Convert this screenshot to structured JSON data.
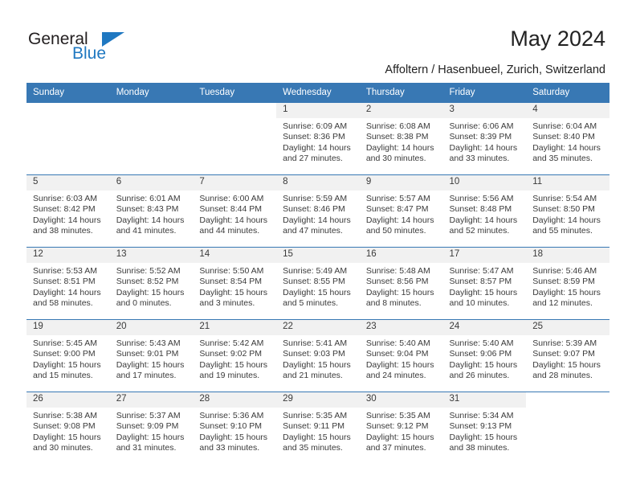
{
  "brand": {
    "name_dark": "General",
    "name_blue": "Blue",
    "accent_color": "#1f78c1",
    "header_color": "#3878b4"
  },
  "header": {
    "title": "May 2024",
    "subtitle": "Affoltern / Hasenbueel, Zurich, Switzerland"
  },
  "calendar": {
    "weekday_headers": [
      "Sunday",
      "Monday",
      "Tuesday",
      "Wednesday",
      "Thursday",
      "Friday",
      "Saturday"
    ],
    "weeks": [
      [
        {
          "date": "",
          "sunrise": "",
          "sunset": "",
          "daylight_1": "",
          "daylight_2": ""
        },
        {
          "date": "",
          "sunrise": "",
          "sunset": "",
          "daylight_1": "",
          "daylight_2": ""
        },
        {
          "date": "",
          "sunrise": "",
          "sunset": "",
          "daylight_1": "",
          "daylight_2": ""
        },
        {
          "date": "1",
          "sunrise": "Sunrise: 6:09 AM",
          "sunset": "Sunset: 8:36 PM",
          "daylight_1": "Daylight: 14 hours",
          "daylight_2": "and 27 minutes."
        },
        {
          "date": "2",
          "sunrise": "Sunrise: 6:08 AM",
          "sunset": "Sunset: 8:38 PM",
          "daylight_1": "Daylight: 14 hours",
          "daylight_2": "and 30 minutes."
        },
        {
          "date": "3",
          "sunrise": "Sunrise: 6:06 AM",
          "sunset": "Sunset: 8:39 PM",
          "daylight_1": "Daylight: 14 hours",
          "daylight_2": "and 33 minutes."
        },
        {
          "date": "4",
          "sunrise": "Sunrise: 6:04 AM",
          "sunset": "Sunset: 8:40 PM",
          "daylight_1": "Daylight: 14 hours",
          "daylight_2": "and 35 minutes."
        }
      ],
      [
        {
          "date": "5",
          "sunrise": "Sunrise: 6:03 AM",
          "sunset": "Sunset: 8:42 PM",
          "daylight_1": "Daylight: 14 hours",
          "daylight_2": "and 38 minutes."
        },
        {
          "date": "6",
          "sunrise": "Sunrise: 6:01 AM",
          "sunset": "Sunset: 8:43 PM",
          "daylight_1": "Daylight: 14 hours",
          "daylight_2": "and 41 minutes."
        },
        {
          "date": "7",
          "sunrise": "Sunrise: 6:00 AM",
          "sunset": "Sunset: 8:44 PM",
          "daylight_1": "Daylight: 14 hours",
          "daylight_2": "and 44 minutes."
        },
        {
          "date": "8",
          "sunrise": "Sunrise: 5:59 AM",
          "sunset": "Sunset: 8:46 PM",
          "daylight_1": "Daylight: 14 hours",
          "daylight_2": "and 47 minutes."
        },
        {
          "date": "9",
          "sunrise": "Sunrise: 5:57 AM",
          "sunset": "Sunset: 8:47 PM",
          "daylight_1": "Daylight: 14 hours",
          "daylight_2": "and 50 minutes."
        },
        {
          "date": "10",
          "sunrise": "Sunrise: 5:56 AM",
          "sunset": "Sunset: 8:48 PM",
          "daylight_1": "Daylight: 14 hours",
          "daylight_2": "and 52 minutes."
        },
        {
          "date": "11",
          "sunrise": "Sunrise: 5:54 AM",
          "sunset": "Sunset: 8:50 PM",
          "daylight_1": "Daylight: 14 hours",
          "daylight_2": "and 55 minutes."
        }
      ],
      [
        {
          "date": "12",
          "sunrise": "Sunrise: 5:53 AM",
          "sunset": "Sunset: 8:51 PM",
          "daylight_1": "Daylight: 14 hours",
          "daylight_2": "and 58 minutes."
        },
        {
          "date": "13",
          "sunrise": "Sunrise: 5:52 AM",
          "sunset": "Sunset: 8:52 PM",
          "daylight_1": "Daylight: 15 hours",
          "daylight_2": "and 0 minutes."
        },
        {
          "date": "14",
          "sunrise": "Sunrise: 5:50 AM",
          "sunset": "Sunset: 8:54 PM",
          "daylight_1": "Daylight: 15 hours",
          "daylight_2": "and 3 minutes."
        },
        {
          "date": "15",
          "sunrise": "Sunrise: 5:49 AM",
          "sunset": "Sunset: 8:55 PM",
          "daylight_1": "Daylight: 15 hours",
          "daylight_2": "and 5 minutes."
        },
        {
          "date": "16",
          "sunrise": "Sunrise: 5:48 AM",
          "sunset": "Sunset: 8:56 PM",
          "daylight_1": "Daylight: 15 hours",
          "daylight_2": "and 8 minutes."
        },
        {
          "date": "17",
          "sunrise": "Sunrise: 5:47 AM",
          "sunset": "Sunset: 8:57 PM",
          "daylight_1": "Daylight: 15 hours",
          "daylight_2": "and 10 minutes."
        },
        {
          "date": "18",
          "sunrise": "Sunrise: 5:46 AM",
          "sunset": "Sunset: 8:59 PM",
          "daylight_1": "Daylight: 15 hours",
          "daylight_2": "and 12 minutes."
        }
      ],
      [
        {
          "date": "19",
          "sunrise": "Sunrise: 5:45 AM",
          "sunset": "Sunset: 9:00 PM",
          "daylight_1": "Daylight: 15 hours",
          "daylight_2": "and 15 minutes."
        },
        {
          "date": "20",
          "sunrise": "Sunrise: 5:43 AM",
          "sunset": "Sunset: 9:01 PM",
          "daylight_1": "Daylight: 15 hours",
          "daylight_2": "and 17 minutes."
        },
        {
          "date": "21",
          "sunrise": "Sunrise: 5:42 AM",
          "sunset": "Sunset: 9:02 PM",
          "daylight_1": "Daylight: 15 hours",
          "daylight_2": "and 19 minutes."
        },
        {
          "date": "22",
          "sunrise": "Sunrise: 5:41 AM",
          "sunset": "Sunset: 9:03 PM",
          "daylight_1": "Daylight: 15 hours",
          "daylight_2": "and 21 minutes."
        },
        {
          "date": "23",
          "sunrise": "Sunrise: 5:40 AM",
          "sunset": "Sunset: 9:04 PM",
          "daylight_1": "Daylight: 15 hours",
          "daylight_2": "and 24 minutes."
        },
        {
          "date": "24",
          "sunrise": "Sunrise: 5:40 AM",
          "sunset": "Sunset: 9:06 PM",
          "daylight_1": "Daylight: 15 hours",
          "daylight_2": "and 26 minutes."
        },
        {
          "date": "25",
          "sunrise": "Sunrise: 5:39 AM",
          "sunset": "Sunset: 9:07 PM",
          "daylight_1": "Daylight: 15 hours",
          "daylight_2": "and 28 minutes."
        }
      ],
      [
        {
          "date": "26",
          "sunrise": "Sunrise: 5:38 AM",
          "sunset": "Sunset: 9:08 PM",
          "daylight_1": "Daylight: 15 hours",
          "daylight_2": "and 30 minutes."
        },
        {
          "date": "27",
          "sunrise": "Sunrise: 5:37 AM",
          "sunset": "Sunset: 9:09 PM",
          "daylight_1": "Daylight: 15 hours",
          "daylight_2": "and 31 minutes."
        },
        {
          "date": "28",
          "sunrise": "Sunrise: 5:36 AM",
          "sunset": "Sunset: 9:10 PM",
          "daylight_1": "Daylight: 15 hours",
          "daylight_2": "and 33 minutes."
        },
        {
          "date": "29",
          "sunrise": "Sunrise: 5:35 AM",
          "sunset": "Sunset: 9:11 PM",
          "daylight_1": "Daylight: 15 hours",
          "daylight_2": "and 35 minutes."
        },
        {
          "date": "30",
          "sunrise": "Sunrise: 5:35 AM",
          "sunset": "Sunset: 9:12 PM",
          "daylight_1": "Daylight: 15 hours",
          "daylight_2": "and 37 minutes."
        },
        {
          "date": "31",
          "sunrise": "Sunrise: 5:34 AM",
          "sunset": "Sunset: 9:13 PM",
          "daylight_1": "Daylight: 15 hours",
          "daylight_2": "and 38 minutes."
        },
        {
          "date": "",
          "sunrise": "",
          "sunset": "",
          "daylight_1": "",
          "daylight_2": ""
        }
      ]
    ]
  }
}
